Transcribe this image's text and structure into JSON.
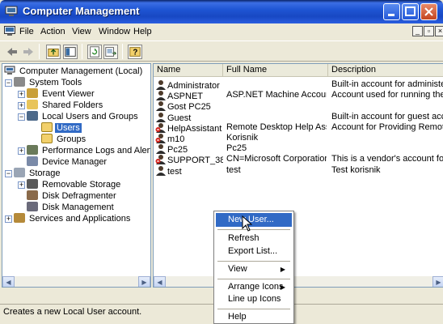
{
  "window": {
    "title": "Computer Management"
  },
  "menubar": {
    "items": [
      "File",
      "Action",
      "View",
      "Window",
      "Help"
    ]
  },
  "tree": {
    "root": "Computer Management (Local)",
    "system_tools": "System Tools",
    "event_viewer": "Event Viewer",
    "shared_folders": "Shared Folders",
    "local_users": "Local Users and Groups",
    "users": "Users",
    "groups": "Groups",
    "perf_logs": "Performance Logs and Alerts",
    "device_manager": "Device Manager",
    "storage": "Storage",
    "removable_storage": "Removable Storage",
    "disk_defrag": "Disk Defragmenter",
    "disk_management": "Disk Management",
    "services": "Services and Applications"
  },
  "list": {
    "columns": [
      "Name",
      "Full Name",
      "Description"
    ],
    "rows": [
      {
        "name": "Administrator",
        "full": "",
        "desc": "Built-in account for administering t",
        "icon": "user-icon"
      },
      {
        "name": "ASPNET",
        "full": "ASP.NET Machine Account",
        "desc": "Account used for running the ASP",
        "icon": "user-icon"
      },
      {
        "name": "Gost PC25",
        "full": "",
        "desc": "",
        "icon": "user-icon"
      },
      {
        "name": "Guest",
        "full": "",
        "desc": "Built-in account for guest access t",
        "icon": "user-icon"
      },
      {
        "name": "HelpAssistant",
        "full": "Remote Desktop Help Assi...",
        "desc": "Account for Providing Remote Ass",
        "icon": "disabled-user-icon"
      },
      {
        "name": "m10",
        "full": "Korisnik",
        "desc": "",
        "icon": "disabled-user-icon"
      },
      {
        "name": "Pc25",
        "full": "Pc25",
        "desc": "",
        "icon": "user-icon"
      },
      {
        "name": "SUPPORT_38...",
        "full": "CN=Microsoft Corporation...",
        "desc": "This is a vendor's account for the",
        "icon": "disabled-user-icon"
      },
      {
        "name": "test",
        "full": "test",
        "desc": "Test korisnik",
        "icon": "user-icon"
      }
    ]
  },
  "context_menu": {
    "new_user": "New User...",
    "refresh": "Refresh",
    "export": "Export List...",
    "view": "View",
    "arrange": "Arrange Icons",
    "lineup": "Line up Icons",
    "help": "Help"
  },
  "status": {
    "text": "Creates a new Local User account."
  },
  "colors": {
    "titlebar": "#1f55d4",
    "selection": "#316ac5",
    "disabled_user_badge": "#d4201a"
  }
}
